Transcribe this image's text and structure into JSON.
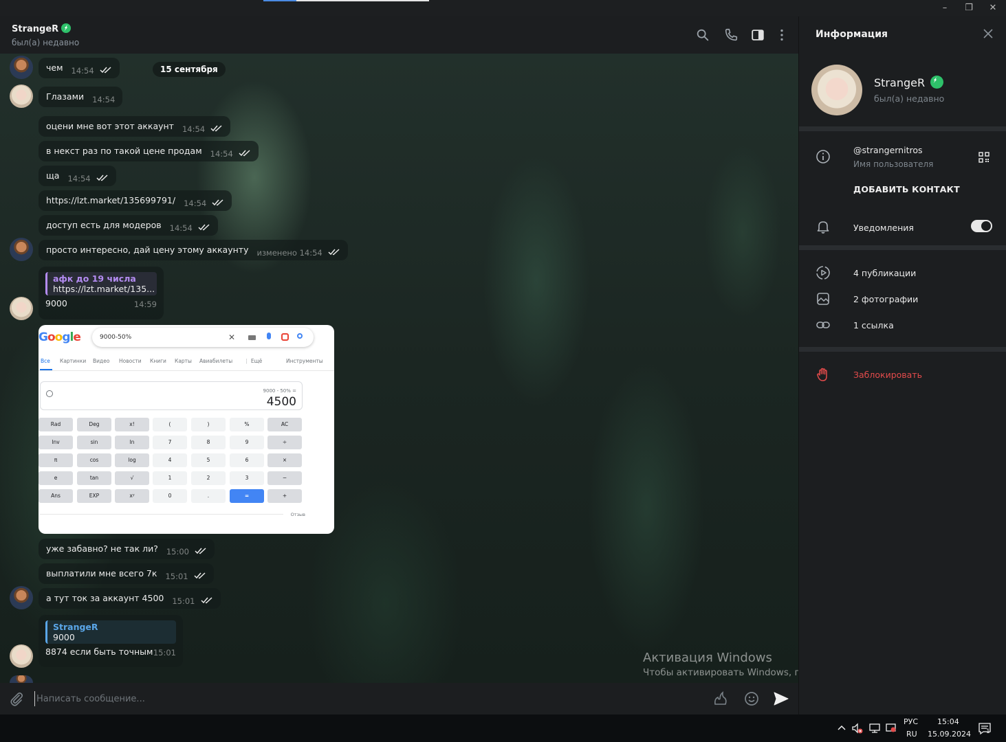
{
  "window": {
    "minimize": "–",
    "restore": "❐",
    "close": "✕"
  },
  "header": {
    "title": "StrangeR",
    "status": "был(а) недавно"
  },
  "chat": {
    "date_pill": "15 сентября",
    "messages": [
      {
        "text": "чем",
        "time": "14:54"
      },
      {
        "text": "Глазами",
        "time": "14:54"
      },
      {
        "text": "оцени мне вот этот аккаунт",
        "time": "14:54"
      },
      {
        "text": "в некст раз по такой цене продам",
        "time": "14:54"
      },
      {
        "text": "ща",
        "time": "14:54"
      },
      {
        "text": "https://lzt.market/135699791/",
        "time": "14:54"
      },
      {
        "text": "доступ есть для модеров",
        "time": "14:54"
      },
      {
        "text": "просто интересно, дай цену этому аккаунту",
        "time": "изменено 14:54"
      },
      {
        "text": "уже забавно? не так ли?",
        "time": "15:00"
      },
      {
        "text": "выплатили мне всего 7к",
        "time": "15:01"
      },
      {
        "text": "а тут ток за аккаунт 4500",
        "time": "15:01"
      }
    ],
    "reply1": {
      "quote_author": "афк до 19 числа",
      "quote_text": "https://lzt.market/135...",
      "text": "9000",
      "time": "14:59"
    },
    "reply2": {
      "quote_author": "StrangeR",
      "quote_text": "9000",
      "text": "8874 если быть точным",
      "time": "15:01"
    }
  },
  "screenshot": {
    "logo": "Google",
    "query": "9000-50%",
    "tabs": [
      "Все",
      "Картинки",
      "Видео",
      "Новости",
      "Книги",
      "Карты",
      "Авиабилеты",
      "⋮ Ещё",
      "Инструменты"
    ],
    "expression": "9000 - 50% =",
    "result": "4500",
    "keys": [
      [
        "Rad",
        "Deg",
        "x!",
        "(",
        ")",
        "%",
        "AC"
      ],
      [
        "Inv",
        "sin",
        "ln",
        "7",
        "8",
        "9",
        "÷"
      ],
      [
        "π",
        "cos",
        "log",
        "4",
        "5",
        "6",
        "×"
      ],
      [
        "e",
        "tan",
        "√",
        "1",
        "2",
        "3",
        "−"
      ],
      [
        "Ans",
        "EXP",
        "xʸ",
        "0",
        ".",
        "=",
        "+"
      ]
    ],
    "footer": "Отзыв"
  },
  "watermark": {
    "title": "Активация Windows",
    "subtitle": "Чтобы активировать Windows, перейдите в раздел \"Параметры\"."
  },
  "composer": {
    "placeholder": "Написать сообщение..."
  },
  "info": {
    "title": "Информация",
    "name": "StrangeR",
    "status": "был(а) недавно",
    "username": "@strangernitros",
    "username_label": "Имя пользователя",
    "add_contact": "ДОБАВИТЬ КОНТАКТ",
    "notifications": "Уведомления",
    "notifications_on": true,
    "publications": "4 публикации",
    "photos": "2 фотографии",
    "links": "1 ссылка",
    "block": "Заблокировать"
  },
  "taskbar": {
    "lang_top": "РУС",
    "lang_bottom": "RU",
    "time": "15:04",
    "date": "15.09.2024",
    "notifications_count": "1"
  },
  "colors": {
    "accent": "#5aa6e8",
    "verified": "#2ec16a",
    "danger": "#e34b4b",
    "quote_purple": "#b48cf2"
  }
}
